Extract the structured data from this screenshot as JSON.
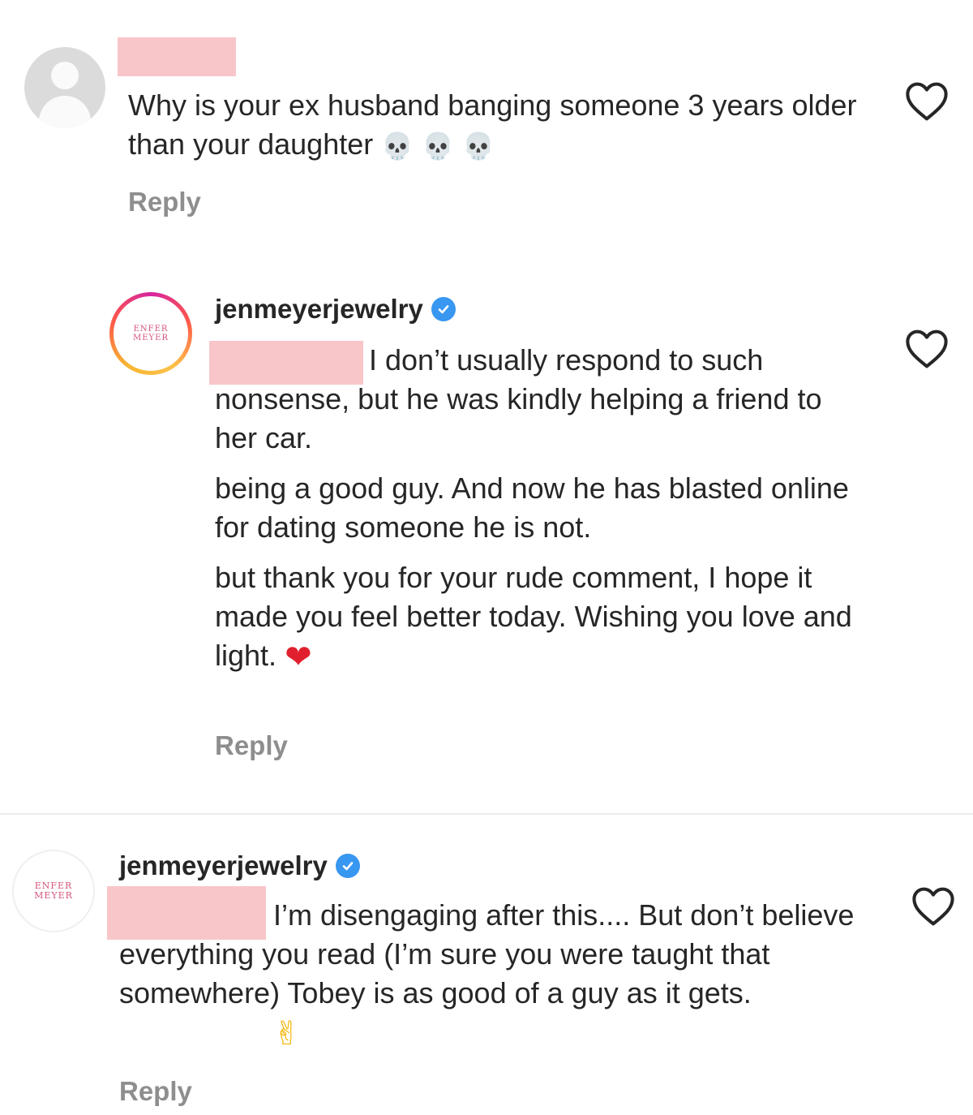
{
  "comments": [
    {
      "username": "",
      "text": "Why is your ex husband banging someone 3 years older than your daughter",
      "emoji": [
        "💀",
        "💀",
        "💀"
      ],
      "reply_label": "Reply",
      "avatar_icon": "default-avatar-icon"
    },
    {
      "username": "jenmeyerjewelry",
      "verified": true,
      "paragraphs": [
        "I don’t usually respond to such nonsense, but he was kindly helping a friend to her car.",
        "being a good guy. And now he has blasted online for dating someone he is not.",
        "but thank you for your rude comment, I hope it made you feel better today. Wishing you love and light."
      ],
      "emoji": "❤",
      "reply_label": "Reply",
      "avatar_logo": [
        "ENFER",
        "MEYER"
      ]
    },
    {
      "username": "jenmeyerjewelry",
      "verified": true,
      "text": "I’m disengaging after this.... But don’t believe everything you read (I’m sure you were taught that somewhere) Tobey is as good of a guy as it gets.",
      "emoji": "✌",
      "reply_label": "Reply",
      "avatar_logo": [
        "ENFER",
        "MEYER"
      ]
    }
  ],
  "colors": {
    "redaction": "#f8c6c9",
    "reply_text": "#8e8e8e",
    "verified_badge": "#3897f0",
    "heart_emoji": "#e0202e"
  },
  "icons": [
    "heart-outline-icon",
    "verified-badge-icon",
    "default-avatar-icon",
    "skull-emoji",
    "red-heart-emoji",
    "victory-hand-emoji"
  ]
}
